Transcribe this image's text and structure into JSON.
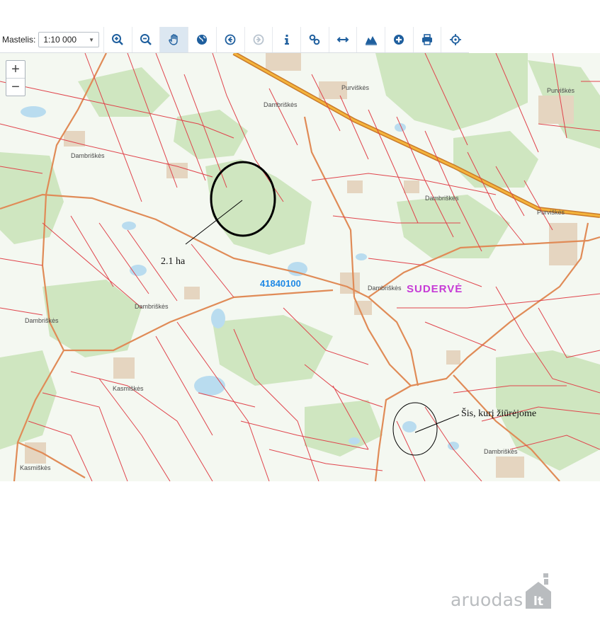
{
  "toolbar": {
    "scale_label": "Mastelis:",
    "scale_value": "1:10 000",
    "tools": [
      {
        "name": "zoom-in-icon"
      },
      {
        "name": "zoom-out-icon"
      },
      {
        "name": "pan-hand-icon",
        "active": true
      },
      {
        "name": "globe-icon"
      },
      {
        "name": "back-arrow-icon"
      },
      {
        "name": "forward-arrow-icon",
        "disabled": true
      },
      {
        "name": "info-icon"
      },
      {
        "name": "link-icon"
      },
      {
        "name": "measure-distance-icon"
      },
      {
        "name": "elevation-profile-icon"
      },
      {
        "name": "add-icon"
      },
      {
        "name": "print-icon"
      },
      {
        "name": "locate-icon"
      }
    ]
  },
  "map": {
    "zoom_in": "+",
    "zoom_out": "−",
    "place_labels": {
      "purviskes_1": "Purviškės",
      "purviskes_2": "Purviškės",
      "purviskes_3": "Purviškės",
      "dambriskes_1": "Dambriškės",
      "dambriskes_2": "Dambriškės",
      "dambriskes_3": "Dambriškės",
      "dambriskes_4": "Dambriškės",
      "dambriskes_5": "Dambriškės",
      "dambriskes_6": "Dambriškės",
      "dambriskes_7": "Dambriškės",
      "kasmiskes_1": "Kasmiškės",
      "kasmiskes_2": "Kasmiškės"
    },
    "parcel_id": "41840100",
    "district": "SUDERVĖ",
    "annotation_area": "2.1 ha",
    "annotation_pond": "Šis, kurį žiūrėjome"
  },
  "watermark": {
    "text": "aruodas",
    "badge": "lt"
  }
}
